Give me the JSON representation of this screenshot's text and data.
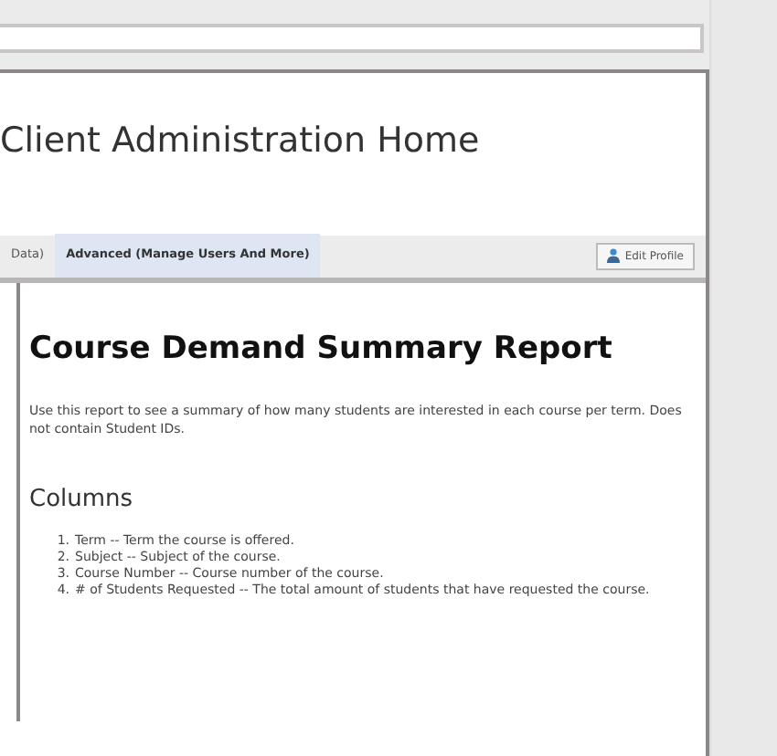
{
  "page_title": "Client Administration Home",
  "tabs": [
    {
      "label": "Data)",
      "selected": false
    },
    {
      "label": "Advanced (Manage Users And More)",
      "selected": true
    }
  ],
  "edit_profile_button": "Edit Profile",
  "report": {
    "title": "Course Demand Summary Report",
    "description": "Use this report to see a summary of how many students are interested in each course per term. Does not contain Student IDs.",
    "columns_heading": "Columns",
    "columns": [
      {
        "number": "1.",
        "text": "Term -- Term the course is offered."
      },
      {
        "number": "2.",
        "text": "Subject -- Subject of the course."
      },
      {
        "number": "3.",
        "text": "Course Number -- Course number of the course."
      },
      {
        "number": "4.",
        "text": "# of Students Requested -- The total amount of students that have requested the course."
      }
    ]
  }
}
